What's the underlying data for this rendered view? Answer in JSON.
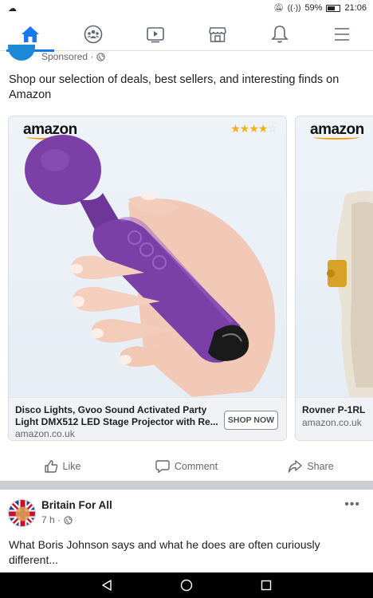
{
  "status_bar": {
    "time": "21:06",
    "battery": "59%"
  },
  "nav": {
    "items": [
      {
        "icon": "home-icon",
        "active": true
      },
      {
        "icon": "groups-icon",
        "active": false
      },
      {
        "icon": "watch-icon",
        "active": false
      },
      {
        "icon": "marketplace-icon",
        "active": false
      },
      {
        "icon": "notifications-icon",
        "active": false
      },
      {
        "icon": "menu-icon",
        "active": false
      }
    ]
  },
  "sponsored_post": {
    "meta": "Sponsored ·",
    "text": "Shop our selection of deals, best sellers, and interesting finds on Amazon",
    "cards": [
      {
        "brand": "amazon",
        "rating_filled": "★★★★",
        "rating_empty": "☆",
        "title": "Disco Lights, Gvoo Sound Activated Party Light DMX512 LED Stage Projector with Re...",
        "domain": "amazon.co.uk",
        "cta": "SHOP NOW"
      },
      {
        "brand": "amazon",
        "title": "Rovner P-1RL",
        "domain": "amazon.co.uk"
      }
    ],
    "actions": {
      "like": "Like",
      "comment": "Comment",
      "share": "Share"
    }
  },
  "next_post": {
    "author": "Britain For All",
    "time": "7 h ·",
    "more": "•••",
    "text": "What Boris Johnson says and what he does are often curiously different..."
  },
  "colors": {
    "accent": "#1877f2",
    "product_purple": "#7b3fa8",
    "amazon_orange": "#ff9900"
  }
}
